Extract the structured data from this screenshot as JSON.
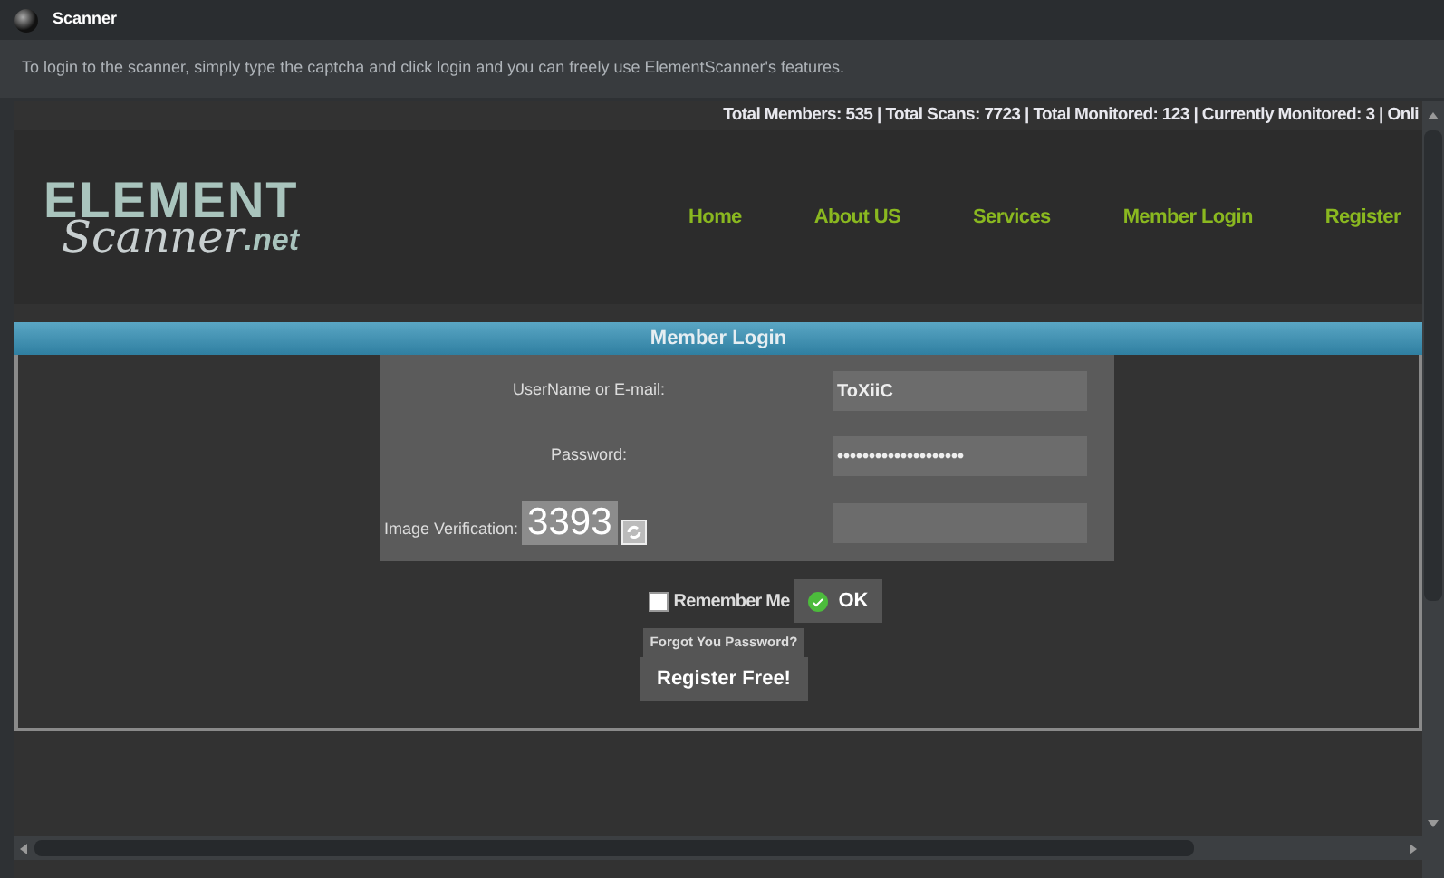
{
  "window": {
    "title": "Scanner"
  },
  "hint": "To login to the scanner, simply type the captcha and click login and you can freely use ElementScanner's features.",
  "stats": "Total Members: 535 | Total Scans: 7723 | Total Monitored: 123 | Currently Monitored: 3 | Onli",
  "logo": {
    "line_1": "ELEMENT",
    "line_2": "Scanner",
    "suffix": ".net"
  },
  "nav": [
    {
      "label": "Home"
    },
    {
      "label": "About US"
    },
    {
      "label": "Services"
    },
    {
      "label": "Member Login"
    },
    {
      "label": "Register"
    }
  ],
  "login": {
    "title": "Member Login",
    "fields": [
      {
        "label": "UserName or E-mail:",
        "value": "ToXiiC"
      },
      {
        "label": "Password:",
        "value": "••••••••••••••••••••"
      },
      {
        "label": "Image Verification:",
        "captcha": "3393"
      }
    ],
    "remember": {
      "label": "Remember Me",
      "checked": false
    },
    "ok": "OK",
    "forgot": "Forgot You Password?",
    "register": "Register Free!"
  }
}
